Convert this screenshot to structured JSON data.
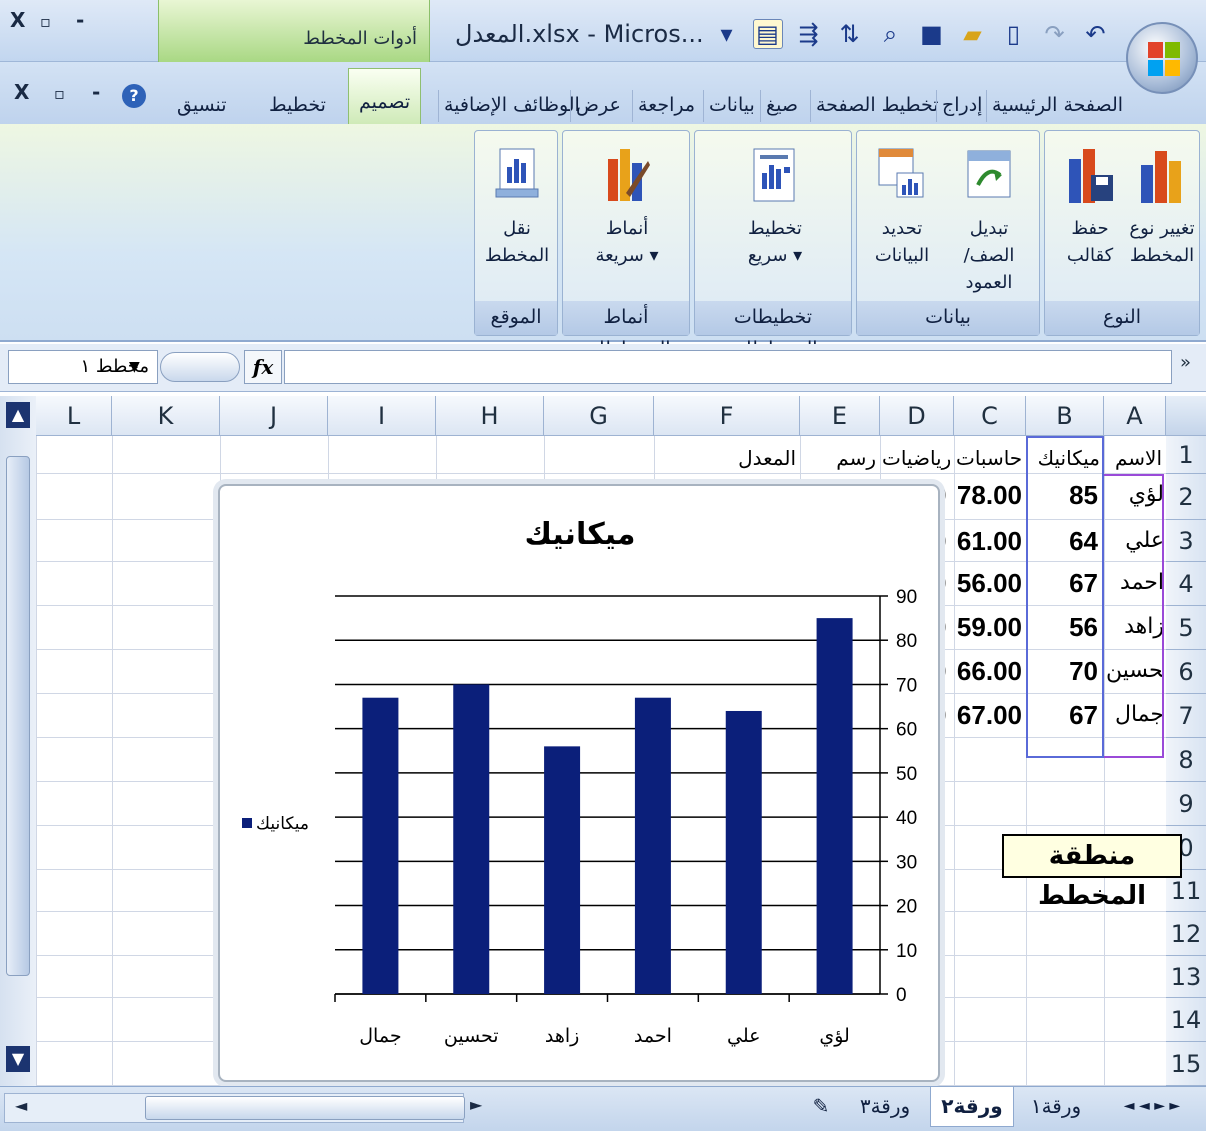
{
  "titlebar": {
    "chart_tools": "أدوات المخطط",
    "doc_title": "المعدل.xlsx - Micros...",
    "close": "X",
    "restore": "▫",
    "minimize": "-"
  },
  "tabs": {
    "home": "الصفحة الرئيسية",
    "insert": "إدراج",
    "page_layout": "تخطيط الصفحة",
    "formulas": "صيغ",
    "data": "بيانات",
    "review": "مراجعة",
    "view": "عرض",
    "addins": "الوظائف الإضافية",
    "design": "تصميم",
    "layout": "تخطيط",
    "format": "تنسيق",
    "help": "?"
  },
  "ribbon": {
    "groups": {
      "type": "النوع",
      "data": "بيانات",
      "layouts": "تخطيطات المخططات",
      "styles": "أنماط المخططات",
      "location": "الموقع"
    },
    "buttons": {
      "change_type_1": "تغيير نوع",
      "change_type_2": "المخطط",
      "save_template_1": "حفظ",
      "save_template_2": "كقالب",
      "switch_row_1": "تبديل",
      "switch_row_2": "الصف/العمود",
      "select_data_1": "تحديد",
      "select_data_2": "البيانات",
      "quick_layout_1": "تخطيط",
      "quick_layout_2": "سريع ▾",
      "quick_styles_1": "أنماط",
      "quick_styles_2": "سريعة ▾",
      "move_chart_1": "نقل",
      "move_chart_2": "المخطط"
    }
  },
  "formula_bar": {
    "name_box": "مخطط ١",
    "fx": "fx",
    "expand": "»"
  },
  "sheet": {
    "columns": [
      "A",
      "B",
      "C",
      "D",
      "E",
      "F",
      "G",
      "H",
      "I",
      "J",
      "K",
      "L"
    ],
    "rows": [
      "1",
      "2",
      "3",
      "4",
      "5",
      "6",
      "7",
      "8",
      "9",
      "0",
      "11",
      "12",
      "13",
      "14",
      "15"
    ],
    "headers": {
      "A": "الاسم",
      "B": "ميكانيك",
      "C": "حاسبات",
      "D": "رياضيات",
      "E": "رسم",
      "F": "المعدل"
    },
    "names": [
      "لؤي",
      "علي",
      "احمد",
      "زاهد",
      "تحسين",
      "جمال"
    ],
    "mech": [
      "85",
      "64",
      "67",
      "56",
      "70",
      "67"
    ],
    "comp": [
      "78.00",
      "61.00",
      "56.00",
      "59.00",
      "66.00",
      "67.00"
    ],
    "trunc_d": [
      "0",
      "0",
      "0",
      "0",
      "0",
      "0"
    ],
    "selected_handle": "...."
  },
  "tooltip": "منطقة المخطط",
  "chart_data": {
    "type": "bar",
    "title": "ميكانيك",
    "categories": [
      "لؤي",
      "علي",
      "احمد",
      "زاهد",
      "تحسين",
      "جمال"
    ],
    "series": [
      {
        "name": "ميكانيك",
        "values": [
          85,
          64,
          67,
          56,
          70,
          67
        ]
      }
    ],
    "ylim": [
      0,
      90
    ],
    "yticks": [
      "0",
      "10",
      "20",
      "30",
      "40",
      "50",
      "60",
      "70",
      "80",
      "90"
    ],
    "axis_side": "right",
    "legend": "left",
    "grid": true,
    "bar_color": "#0b1f7a"
  },
  "sheet_tabs": {
    "sheet1": "ورقة١",
    "sheet2": "ورقة٢",
    "sheet3": "ورقة٣",
    "nav": "◄ ◄ ► ►"
  }
}
